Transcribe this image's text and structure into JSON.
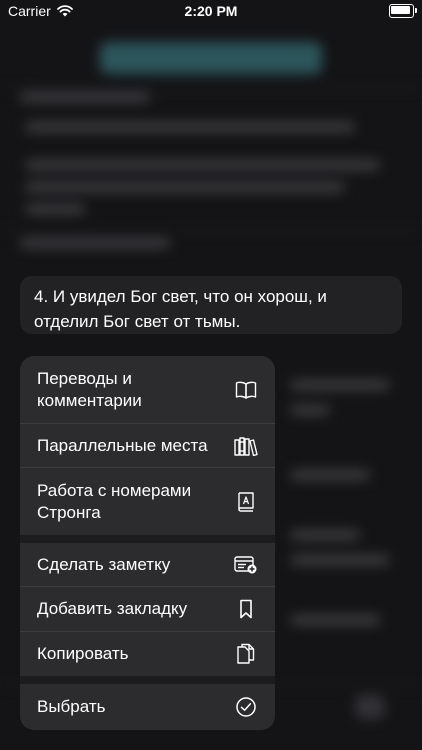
{
  "status_bar": {
    "carrier": "Carrier",
    "time": "2:20 PM"
  },
  "verse_preview": {
    "text": "4. И увидел Бог свет, что он хорош, и отделил Бог свет от тьмы."
  },
  "context_menu": {
    "items": [
      {
        "label": "Переводы и комментарии",
        "icon": "open-book-icon"
      },
      {
        "label": "Параллельные места",
        "icon": "books-icon"
      },
      {
        "label": "Работа с номерами Стронга",
        "icon": "dictionary-icon"
      },
      {
        "label": "Сделать заметку",
        "icon": "note-add-icon"
      },
      {
        "label": "Добавить закладку",
        "icon": "bookmark-icon"
      },
      {
        "label": "Копировать",
        "icon": "copy-icon"
      },
      {
        "label": "Выбрать",
        "icon": "checkmark-circle-icon"
      }
    ]
  },
  "colors": {
    "background": "#1b1b1d",
    "menu_background": "#2c2c2e",
    "verse_background": "#222224",
    "text": "#ffffff",
    "blurred_accent": "#3f7f86"
  }
}
